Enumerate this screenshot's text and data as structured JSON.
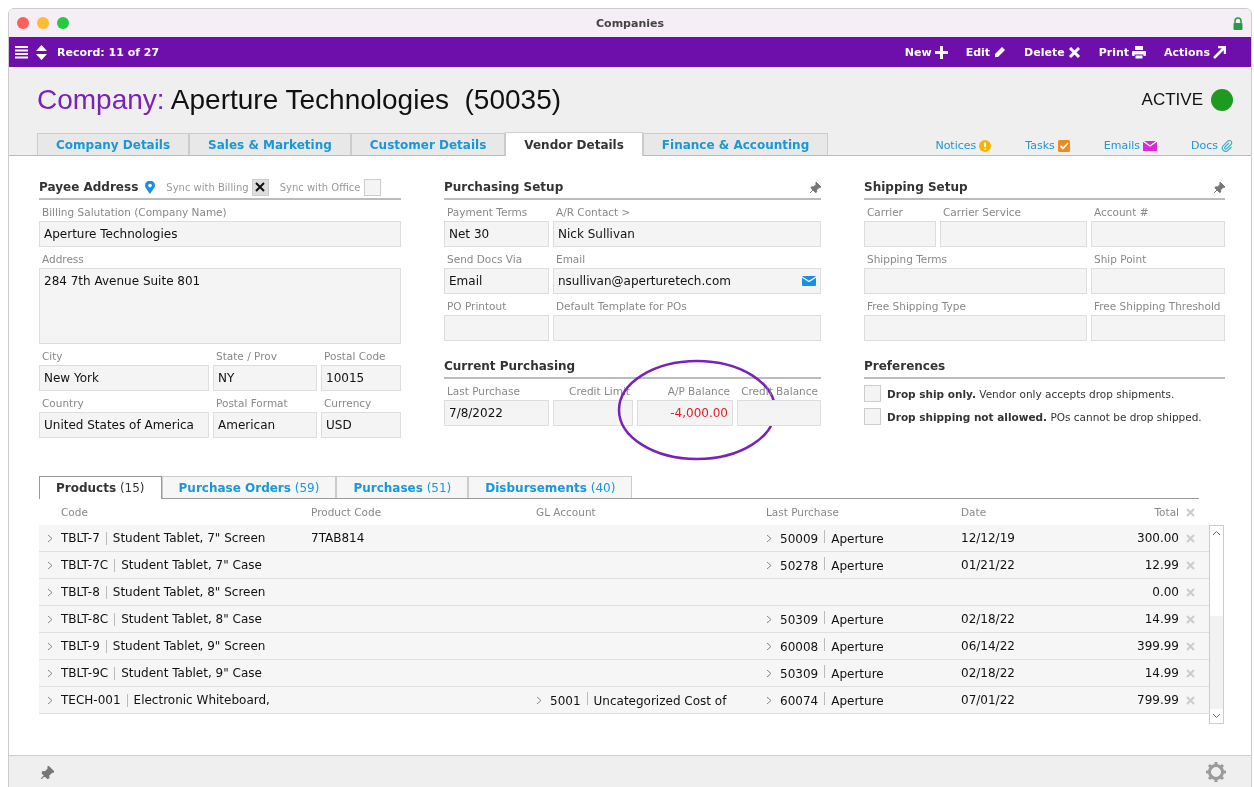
{
  "window": {
    "title": "Companies"
  },
  "toolbar": {
    "record": "Record: 11 of 27",
    "actions": [
      {
        "label": "New",
        "kind": "new"
      },
      {
        "label": "Edit",
        "kind": "edit"
      },
      {
        "label": "Delete",
        "kind": "delete"
      },
      {
        "label": "Print",
        "kind": "print"
      },
      {
        "label": "Actions",
        "kind": "actions"
      }
    ]
  },
  "header": {
    "prefix": "Company:",
    "name": "Aperture Technologies  (50035)",
    "status": "ACTIVE"
  },
  "tabs": [
    {
      "label": "Company Details",
      "selected": false
    },
    {
      "label": "Sales & Marketing",
      "selected": false
    },
    {
      "label": "Customer Details",
      "selected": false
    },
    {
      "label": "Vendor Details",
      "selected": true
    },
    {
      "label": "Finance & Accounting",
      "selected": false
    }
  ],
  "links": [
    {
      "label": "Notices",
      "kind": "notice"
    },
    {
      "label": "Tasks",
      "kind": "task"
    },
    {
      "label": "Emails",
      "kind": "email"
    },
    {
      "label": "Docs",
      "kind": "doc"
    }
  ],
  "payee": {
    "title": "Payee Address",
    "syncs": [
      {
        "label": "Sync with Billing",
        "checked": true
      },
      {
        "label": "Sync with Office",
        "checked": false
      }
    ],
    "rows": [
      [
        {
          "label": "Billing Salutation (Company Name)",
          "value": "Aperture Technologies"
        }
      ],
      [
        {
          "label": "Address",
          "value": "284 7th Avenue Suite 801",
          "kind": "multiline"
        }
      ],
      [
        {
          "label": "City",
          "value": "New York"
        },
        {
          "label": "State / Prov",
          "value": "NY"
        },
        {
          "label": "Postal Code",
          "value": "10015"
        }
      ],
      [
        {
          "label": "Country",
          "value": "United States of America"
        },
        {
          "label": "Postal Format",
          "value": "American"
        },
        {
          "label": "Currency",
          "value": "USD"
        }
      ]
    ]
  },
  "purchasing": {
    "title": "Purchasing Setup",
    "pin": true,
    "rows": [
      [
        {
          "label": "Payment Terms",
          "value": "Net 30"
        },
        {
          "label": "A/R Contact >",
          "value": "Nick Sullivan"
        }
      ],
      [
        {
          "label": "Send Docs Via",
          "value": "Email"
        },
        {
          "label": "Email",
          "value": "nsullivan@aperturetech.com",
          "kind": "email"
        }
      ],
      [
        {
          "label": "PO Printout"
        },
        {
          "label": "Default Template for POs"
        }
      ]
    ]
  },
  "current": {
    "title": "Current Purchasing",
    "rows": [
      [
        {
          "label": "Last Purchase",
          "value": "7/8/2022"
        },
        {
          "label": "Credit Limit",
          "kind": "amount"
        },
        {
          "label": "A/P Balance",
          "value": "-4,000.00",
          "kind": "amount",
          "negative": true,
          "highlighted": true
        },
        {
          "label": "Credit Balance",
          "kind": "amount"
        }
      ]
    ]
  },
  "shipping": {
    "title": "Shipping Setup",
    "pin": true,
    "rows": [
      [
        {
          "label": "Carrier"
        },
        {
          "label": "Carrier Service"
        },
        {
          "label": "Account #"
        }
      ],
      [
        {
          "label": "Shipping Terms"
        },
        {
          "label": "Ship Point"
        }
      ],
      [
        {
          "label": "Free Shipping Type"
        },
        {
          "label": "Free Shipping Threshold"
        }
      ]
    ]
  },
  "preferences": {
    "title": "Preferences",
    "options": [
      {
        "text": "**Drop ship only.** Vendor only accepts drop shipments.",
        "checked": false
      },
      {
        "text": "**Drop shipping not allowed.** POs cannot be drop shipped.",
        "checked": false
      }
    ]
  },
  "related_tabs": [
    {
      "label": "Products",
      "count": "(15)",
      "selected": true
    },
    {
      "label": "Purchase Orders",
      "count": "(59)",
      "selected": false
    },
    {
      "label": "Purchases",
      "count": "(51)",
      "selected": false
    },
    {
      "label": "Disbursements",
      "count": "(40)",
      "selected": false
    }
  ],
  "table": {
    "columns": [
      "Code",
      "Product Code",
      "GL Account",
      "Last Purchase",
      "Date",
      "Total"
    ],
    "rows": [
      {
        "code": "TBLT-7",
        "name": "Student Tablet, 7\" Screen",
        "product_code": "7TAB814",
        "lp_code": "50009",
        "lp_name": "Aperture",
        "date": "12/12/19",
        "total": "300.00"
      },
      {
        "code": "TBLT-7C",
        "name": "Student Tablet, 7\" Case",
        "lp_code": "50278",
        "lp_name": "Aperture",
        "date": "01/21/22",
        "total": "12.99"
      },
      {
        "code": "TBLT-8",
        "name": "Student Tablet, 8\" Screen",
        "total": "0.00"
      },
      {
        "code": "TBLT-8C",
        "name": "Student Tablet, 8\" Case",
        "lp_code": "50309",
        "lp_name": "Aperture",
        "date": "02/18/22",
        "total": "14.99"
      },
      {
        "code": "TBLT-9",
        "name": "Student Tablet, 9\" Screen",
        "lp_code": "60008",
        "lp_name": "Aperture",
        "date": "06/14/22",
        "total": "399.99"
      },
      {
        "code": "TBLT-9C",
        "name": "Student Tablet, 9\" Case",
        "lp_code": "50309",
        "lp_name": "Aperture",
        "date": "02/18/22",
        "total": "14.99"
      },
      {
        "code": "TECH-001",
        "name": "Electronic Whiteboard,",
        "gl_code": "5001",
        "gl_name": "Uncategorized Cost of",
        "lp_code": "60074",
        "lp_name": "Aperture",
        "date": "07/01/22",
        "total": "799.99"
      }
    ]
  }
}
